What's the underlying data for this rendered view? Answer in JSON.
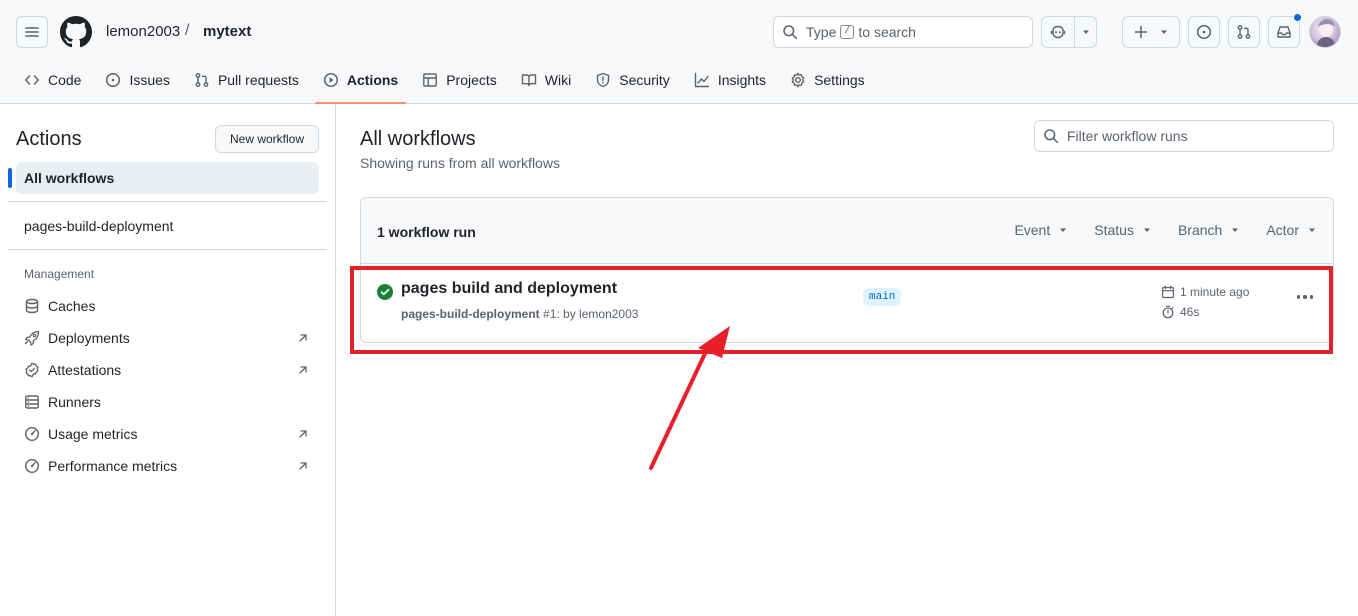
{
  "repo": {
    "owner": "lemon2003",
    "separator": "/",
    "name": "mytext"
  },
  "search": {
    "before": "Type",
    "key": "/",
    "after": "to search"
  },
  "tabs": [
    {
      "label": "Code",
      "icon": "code-icon"
    },
    {
      "label": "Issues",
      "icon": "issue-icon"
    },
    {
      "label": "Pull requests",
      "icon": "pull-request-icon"
    },
    {
      "label": "Actions",
      "icon": "play-icon",
      "active": true
    },
    {
      "label": "Projects",
      "icon": "table-icon"
    },
    {
      "label": "Wiki",
      "icon": "book-icon"
    },
    {
      "label": "Security",
      "icon": "shield-icon"
    },
    {
      "label": "Insights",
      "icon": "graph-icon"
    },
    {
      "label": "Settings",
      "icon": "gear-icon"
    }
  ],
  "sidebar": {
    "title": "Actions",
    "new_workflow": "New workflow",
    "all_workflows": "All workflows",
    "workflows": [
      "pages-build-deployment"
    ],
    "management_label": "Management",
    "management": [
      {
        "label": "Caches",
        "icon": "database-icon"
      },
      {
        "label": "Deployments",
        "icon": "rocket-icon",
        "external": true
      },
      {
        "label": "Attestations",
        "icon": "verified-icon",
        "external": true
      },
      {
        "label": "Runners",
        "icon": "server-icon"
      },
      {
        "label": "Usage metrics",
        "icon": "meter-icon",
        "external": true
      },
      {
        "label": "Performance metrics",
        "icon": "meter-icon",
        "external": true
      }
    ]
  },
  "main": {
    "title": "All workflows",
    "subtitle": "Showing runs from all workflows",
    "filter_placeholder": "Filter workflow runs",
    "run_count": "1 workflow run",
    "filters": [
      "Event",
      "Status",
      "Branch",
      "Actor"
    ],
    "runs": [
      {
        "title": "pages build and deployment",
        "workflow": "pages-build-deployment",
        "meta": "#1: by lemon2003",
        "branch": "main",
        "time": "1 minute ago",
        "duration": "46s",
        "status": "success"
      }
    ]
  },
  "colors": {
    "annotation": "#e8202a",
    "accent": "#0969da",
    "success": "#1a7f37",
    "active_tab": "#fd8c73"
  }
}
